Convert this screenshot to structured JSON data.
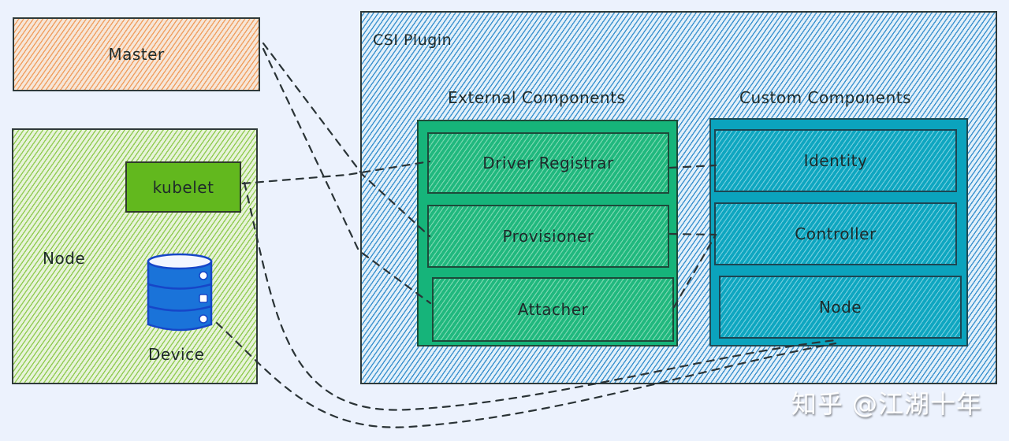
{
  "diagram": {
    "master": {
      "label": "Master",
      "color": "#f0a062"
    },
    "node": {
      "label": "Node",
      "color": "#93cc55",
      "kubelet": {
        "label": "kubelet",
        "color": "#62b81e"
      },
      "device": {
        "label": "Device",
        "icon": "database-icon",
        "color": "#1a73d9"
      }
    },
    "csi_plugin": {
      "label": "CSI Plugin",
      "color": "#3e93cf",
      "external_components": {
        "label": "External Components",
        "color": "#16b47a",
        "items": [
          {
            "label": "Driver Registrar"
          },
          {
            "label": "Provisioner"
          },
          {
            "label": "Attacher"
          }
        ]
      },
      "custom_components": {
        "label": "Custom Components",
        "color": "#0ba3bd",
        "items": [
          {
            "label": "Identity"
          },
          {
            "label": "Controller"
          },
          {
            "label": "Node"
          }
        ]
      }
    },
    "connections": [
      {
        "from": "Master",
        "to": "Provisioner"
      },
      {
        "from": "Master",
        "to": "Attacher"
      },
      {
        "from": "kubelet",
        "to": "Driver Registrar"
      },
      {
        "from": "kubelet",
        "to": "Node"
      },
      {
        "from": "Device",
        "to": "Node"
      },
      {
        "from": "Driver Registrar",
        "to": "Identity"
      },
      {
        "from": "Provisioner",
        "to": "Controller"
      },
      {
        "from": "Attacher",
        "to": "Controller"
      }
    ]
  },
  "watermark": "知乎 @江湖十年"
}
